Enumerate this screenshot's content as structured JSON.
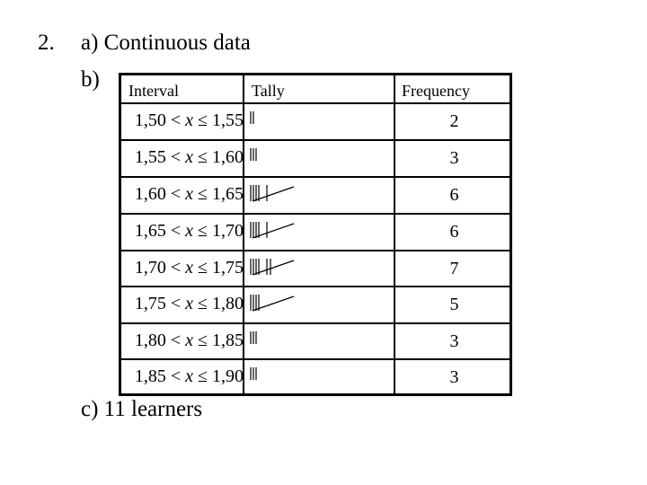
{
  "question": {
    "number": "2.",
    "part_a": "a) Continuous data",
    "part_b": "b)",
    "part_c": "c) 11 learners"
  },
  "table": {
    "headers": {
      "interval": "Interval",
      "tally": "Tally",
      "frequency": "Frequency"
    },
    "rows": [
      {
        "interval": "1,50 < x ≤ 1,55",
        "tally_count": 2,
        "frequency": "2"
      },
      {
        "interval": "1,55 < x ≤ 1,60",
        "tally_count": 3,
        "frequency": "3"
      },
      {
        "interval": "1,60 < x ≤ 1,65",
        "tally_count": 6,
        "frequency": "6"
      },
      {
        "interval": "1,65 < x ≤ 1,70",
        "tally_count": 6,
        "frequency": "6"
      },
      {
        "interval": "1,70 < x ≤ 1,75",
        "tally_count": 7,
        "frequency": "7"
      },
      {
        "interval": "1,75 < x ≤ 1,80",
        "tally_count": 5,
        "frequency": "5"
      },
      {
        "interval": "1,80 < x ≤ 1,85",
        "tally_count": 3,
        "frequency": "3"
      },
      {
        "interval": "1,85 < x ≤ 1,90",
        "tally_count": 3,
        "frequency": "3"
      }
    ]
  }
}
